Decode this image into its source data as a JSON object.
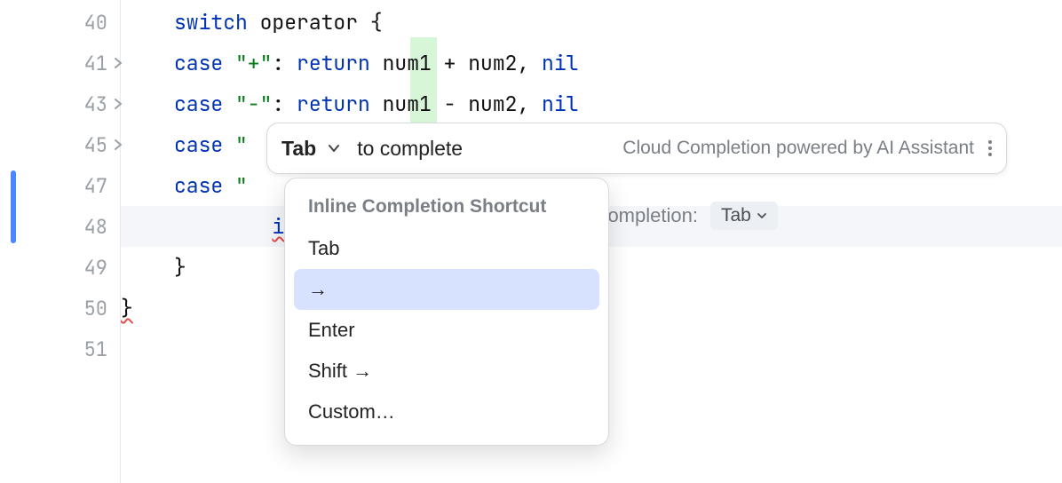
{
  "gutter": {
    "lines": [
      "40",
      "41",
      "43",
      "45",
      "47",
      "48",
      "49",
      "50",
      "51"
    ],
    "foldable": [
      1,
      2,
      3
    ]
  },
  "code": {
    "l40": {
      "indent": "    ",
      "kw": "switch",
      "rest": " operator {"
    },
    "l41": {
      "indent": "    ",
      "kw": "case",
      "str": " \"+\"",
      "colon": ": ",
      "ret": "return",
      "expr": " num1 + num2, ",
      "nil": "nil"
    },
    "l43": {
      "indent": "    ",
      "kw": "case",
      "str": " \"-\"",
      "colon": ": ",
      "ret": "return",
      "expr": " num1 - num2, ",
      "nil": "nil"
    },
    "l45": {
      "indent": "    ",
      "kw": "case",
      "str": " \""
    },
    "l47": {
      "indent": "    ",
      "kw": "case",
      "str": " \""
    },
    "l48": {
      "indent": "        ",
      "kw": "if"
    },
    "l49": {
      "indent": "    ",
      "brace": "}"
    },
    "l50": {
      "indent": "",
      "brace": "}"
    }
  },
  "toolbar": {
    "tab_label": "Tab",
    "to_complete": "to complete",
    "cloud_text": "Cloud Completion powered by AI Assistant"
  },
  "menu": {
    "header": "Inline Completion Shortcut",
    "items": [
      "Tab",
      "→",
      "Enter",
      "Shift →",
      "Custom…"
    ],
    "selected_index": 1
  },
  "hint": {
    "completion_text": "r completion:",
    "pill_label": "Tab"
  }
}
